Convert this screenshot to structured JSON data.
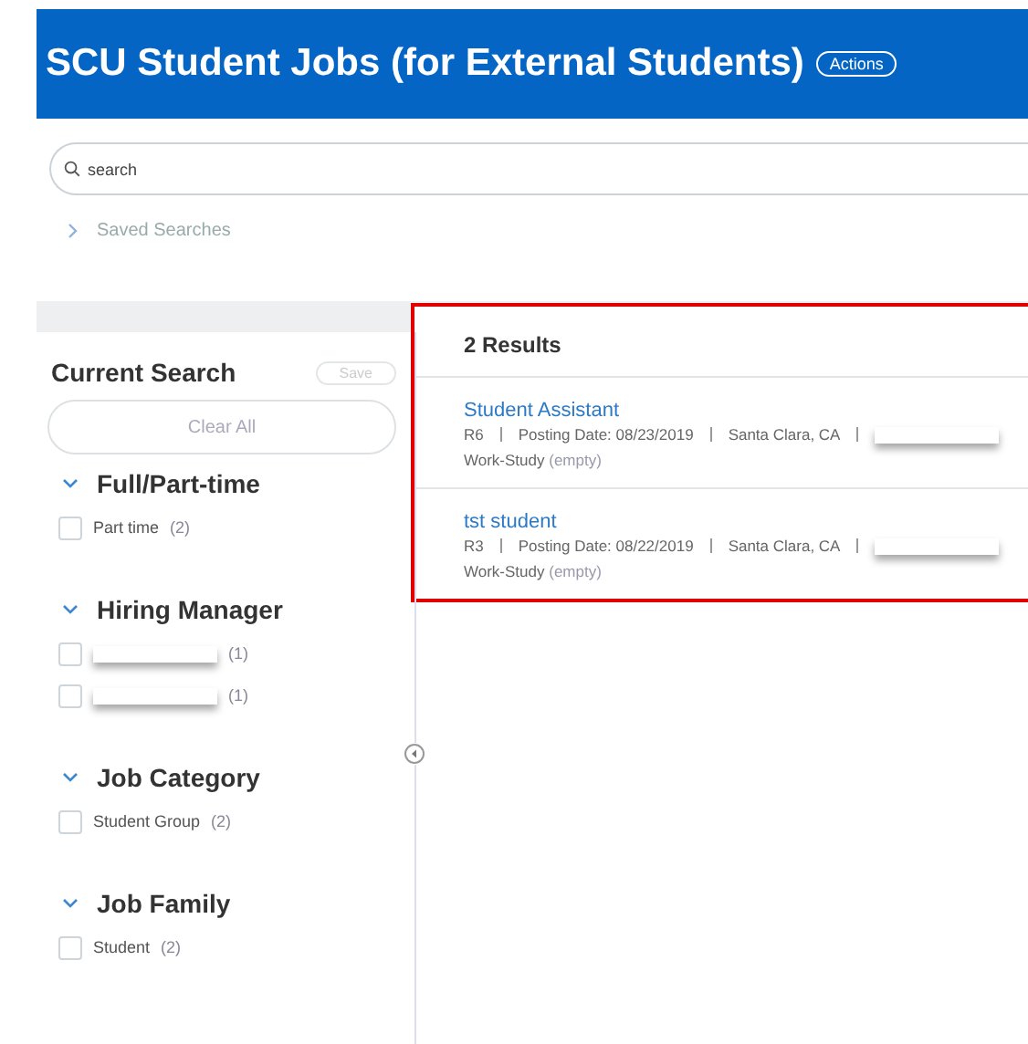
{
  "header": {
    "title": "SCU Student Jobs (for External Students)",
    "actions_label": "Actions"
  },
  "search": {
    "placeholder": "search"
  },
  "saved_searches": {
    "label": "Saved Searches",
    "expanded": false
  },
  "current_search": {
    "title": "Current Search",
    "save_label": "Save",
    "clear_label": "Clear All"
  },
  "facets": [
    {
      "title": "Full/Part-time",
      "expanded": true,
      "options": [
        {
          "kind": "text",
          "label": "Part time",
          "count": "(2)",
          "checked": false
        }
      ]
    },
    {
      "title": "Hiring Manager",
      "expanded": true,
      "options": [
        {
          "kind": "redacted",
          "count": "(1)",
          "checked": false
        },
        {
          "kind": "redacted",
          "count": "(1)",
          "checked": false
        }
      ]
    },
    {
      "title": "Job Category",
      "expanded": true,
      "options": [
        {
          "kind": "text",
          "label": "Student Group",
          "count": "(2)",
          "checked": false
        }
      ]
    },
    {
      "title": "Job Family",
      "expanded": true,
      "options": [
        {
          "kind": "text",
          "label": "Student",
          "count": "(2)",
          "checked": false
        }
      ]
    }
  ],
  "results": {
    "count_label": "2 Results",
    "highlighted": true,
    "items": [
      {
        "title": "Student Assistant",
        "meta": [
          "R6",
          "Posting Date: 08/23/2019",
          "Santa Clara, CA"
        ],
        "meta_redacted": true,
        "work_study_label": "Work-Study",
        "work_study_value": "(empty)"
      },
      {
        "title": "tst student",
        "meta": [
          "R3",
          "Posting Date: 08/22/2019",
          "Santa Clara, CA"
        ],
        "meta_redacted": true,
        "work_study_label": "Work-Study",
        "work_study_value": "(empty)"
      }
    ]
  }
}
